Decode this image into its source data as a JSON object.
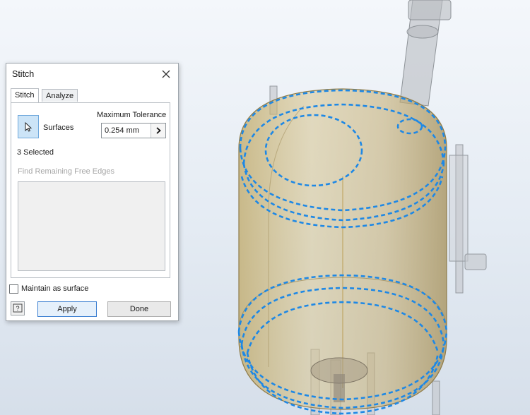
{
  "dialog": {
    "title": "Stitch",
    "tabs": [
      {
        "label": "Stitch",
        "active": true
      },
      {
        "label": "Analyze",
        "active": false
      }
    ],
    "surfaces_label": "Surfaces",
    "max_tolerance_label": "Maximum Tolerance",
    "tolerance_value": "0.254 mm",
    "selected_count": "3 Selected",
    "find_edges_label": "Find Remaining Free Edges",
    "maintain_label": "Maintain as surface",
    "maintain_checked": false,
    "help_label": "?",
    "apply_label": "Apply",
    "done_label": "Done"
  },
  "icons": [
    "close-icon",
    "cursor-arrow-icon",
    "chevron-right-icon",
    "help-icon"
  ],
  "colors": {
    "selection_edge": "#1e88e5",
    "tank_surface": "#c9b276",
    "viewport_bg": "#e6ecf3",
    "accent": "#3c7fd1"
  }
}
